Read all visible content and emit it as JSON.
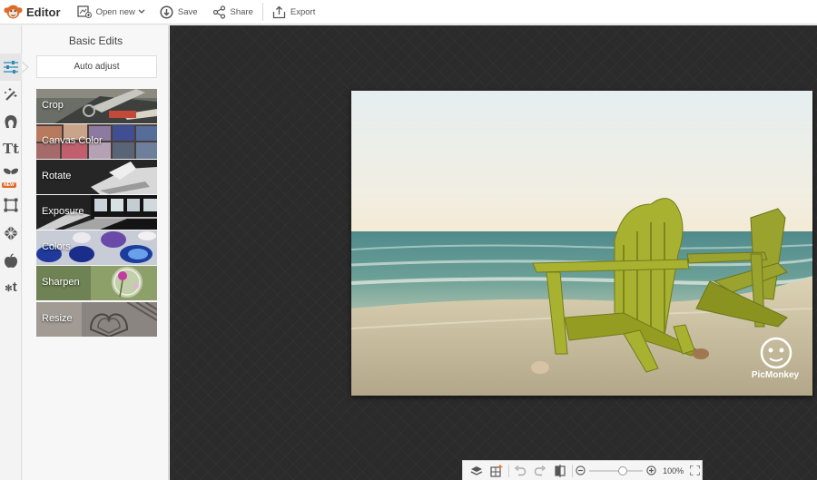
{
  "app": {
    "brand_name": "Editor",
    "brand_icon": "monkey-logo-icon",
    "accent_color": "#e06a2b"
  },
  "toolbar": {
    "open_new_label": "Open new",
    "save_label": "Save",
    "share_label": "Share",
    "export_label": "Export"
  },
  "rail": {
    "items": [
      {
        "name": "basic-edits",
        "icon": "sliders-icon",
        "active": true
      },
      {
        "name": "effects",
        "icon": "magic-wand-icon"
      },
      {
        "name": "touch-up",
        "icon": "face-icon"
      },
      {
        "name": "text",
        "icon": "text-icon",
        "glyph": "Tt"
      },
      {
        "name": "overlays",
        "icon": "butterfly-icon",
        "badge": "NEW"
      },
      {
        "name": "frames",
        "icon": "frame-icon"
      },
      {
        "name": "textures",
        "icon": "texture-icon"
      },
      {
        "name": "themes",
        "icon": "apple-icon"
      },
      {
        "name": "seasonal",
        "icon": "snowflake-t-icon",
        "glyph": "t"
      }
    ]
  },
  "panel": {
    "title": "Basic Edits",
    "auto_adjust_label": "Auto adjust",
    "tools": [
      {
        "label": "Crop"
      },
      {
        "label": "Canvas Color"
      },
      {
        "label": "Rotate"
      },
      {
        "label": "Exposure"
      },
      {
        "label": "Colors"
      },
      {
        "label": "Sharpen"
      },
      {
        "label": "Resize"
      }
    ]
  },
  "photo": {
    "watermark_text": "PicMonkey",
    "subject": "two green adirondack chairs on a beach"
  },
  "zoombar": {
    "zoom_percent_label": "100%",
    "zoom_level": 0.62
  }
}
